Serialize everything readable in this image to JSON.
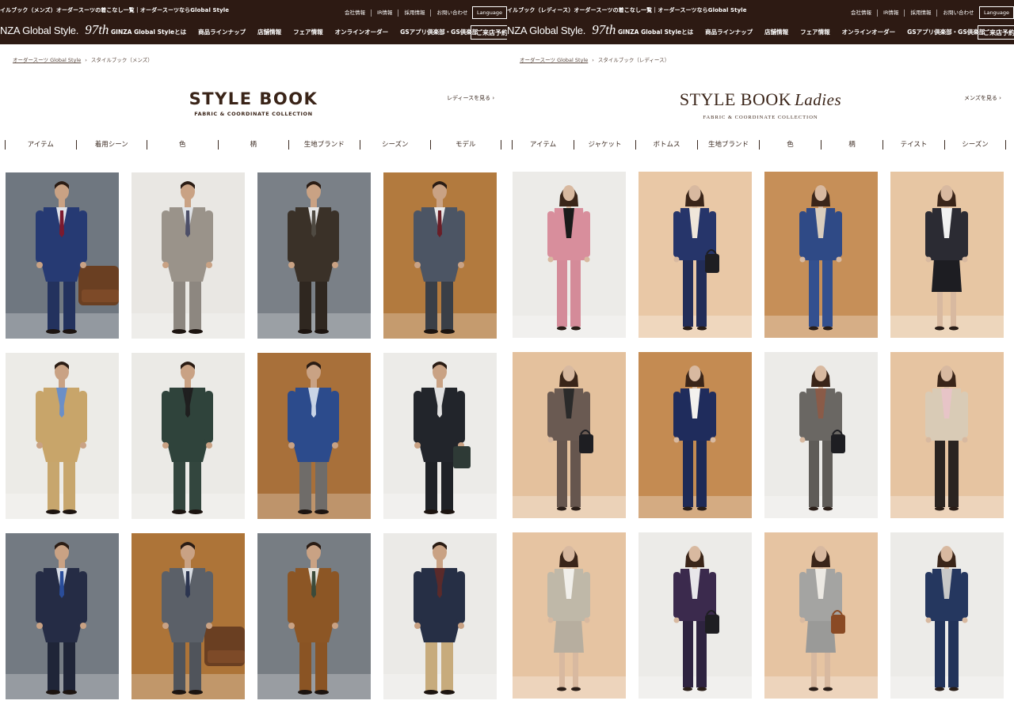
{
  "mens": {
    "site_caption": "イルブック（メンズ）オーダースーツの着こなし一覧｜オーダースーツならGlobal Style",
    "utility_links": [
      "会社情報",
      "IR情報",
      "採用情報",
      "お問い合わせ"
    ],
    "language_label": "Language",
    "logo_text": "NZA Global Style.",
    "logo_97": "97th",
    "nav_items": [
      "GINZA Global Styleとは",
      "商品ラインナップ",
      "店舗情報",
      "フェア情報",
      "オンラインオーダー",
      "GSアプリ倶楽部・GS倶楽部"
    ],
    "reserve_label": "ご来店予約",
    "breadcrumb_home": "オーダースーツ Global Style",
    "breadcrumb_current": "スタイルブック（メンズ）",
    "title": "STYLE BOOK",
    "subtitle": "FABRIC & COORDINATE COLLECTION",
    "switch_link": "レディースを見る ›",
    "filters": [
      "アイテム",
      "着用シーン",
      "色",
      "柄",
      "生地ブランド",
      "シーズン",
      "モデル"
    ],
    "tiles": [
      {
        "bg": "#6f7780",
        "jacket": "#263a73",
        "pants": "#23325e",
        "shirt": "#dfe3ea",
        "tie": "#7b1a2e",
        "prop": "chair"
      },
      {
        "bg": "#e9e7e3",
        "jacket": "#9a938a",
        "pants": "#8d8780",
        "shirt": "#dfe2e6",
        "tie": "#4d4f68",
        "prop": "none"
      },
      {
        "bg": "#7a8087",
        "jacket": "#3a3128",
        "pants": "#2f2720",
        "shirt": "#e6e6e6",
        "tie": "#4f4a42",
        "prop": "none"
      },
      {
        "bg": "#b27a3e",
        "jacket": "#4c5564",
        "pants": "#3a3f47",
        "shirt": "#e8e8e8",
        "tie": "#6a1e27",
        "prop": "none"
      },
      {
        "bg": "#ecebe7",
        "jacket": "#c8a56a",
        "pants": "#c7a66d",
        "shirt": "#6b8fc7",
        "tie": "#6b8fc7",
        "prop": "none"
      },
      {
        "bg": "#ebeae6",
        "jacket": "#2f433b",
        "pants": "#33463e",
        "shirt": "#1f1f1f",
        "tie": "#1f1f1f",
        "prop": "none"
      },
      {
        "bg": "#a8703a",
        "jacket": "#2c4b8c",
        "pants": "#6f6c69",
        "shirt": "#c9d4e6",
        "tie": "#c9d4e6",
        "prop": "none"
      },
      {
        "bg": "#ecebe8",
        "jacket": "#22252b",
        "pants": "#1f2227",
        "shirt": "#e0e0e0",
        "tie": "#e0e0e0",
        "prop": "bag"
      },
      {
        "bg": "#737a82",
        "jacket": "#252c45",
        "pants": "#1f2538",
        "shirt": "#d8dde6",
        "tie": "#2a4d9a",
        "prop": "none"
      },
      {
        "bg": "#ad7438",
        "jacket": "#5b6068",
        "pants": "#50545b",
        "shirt": "#d9dde3",
        "tie": "#2c3550",
        "prop": "chair"
      },
      {
        "bg": "#777d83",
        "jacket": "#8c5625",
        "pants": "#8a5424",
        "shirt": "#e4e0d8",
        "tie": "#3b4a3a",
        "prop": "none"
      },
      {
        "bg": "#ebeae7",
        "jacket": "#262f45",
        "pants": "#c7ab7c",
        "shirt": "#5a2a2a",
        "tie": "#5a2a2a",
        "prop": "none"
      }
    ]
  },
  "ladies": {
    "site_caption": "イルブック（レディース）オーダースーツの着こなし一覧｜オーダースーツならGlobal Style",
    "utility_links": [
      "会社情報",
      "IR情報",
      "採用情報",
      "お問い合わせ"
    ],
    "language_label": "Language",
    "logo_text": "NZA Global Style.",
    "logo_97": "97th",
    "nav_items": [
      "GINZA Global Styleとは",
      "商品ラインナップ",
      "店舗情報",
      "フェア情報",
      "オンラインオーダー",
      "GSアプリ倶楽部・GS倶楽部"
    ],
    "reserve_label": "ご来店予約",
    "breadcrumb_home": "オーダースーツ Global Style",
    "breadcrumb_current": "スタイルブック（レディース）",
    "title": "STYLE BOOK",
    "title_script": "Ladies",
    "subtitle": "FABRIC & COORDINATE COLLECTION",
    "switch_link": "メンズを見る ›",
    "filters": [
      "アイテム",
      "ジャケット",
      "ボトムス",
      "生地ブランド",
      "色",
      "柄",
      "テイスト",
      "シーズン"
    ],
    "tiles": [
      {
        "bg": "#ecebe8",
        "jacket": "#d88e9c",
        "pants": "#d48b99",
        "shirt": "#1a1a1a",
        "prop": "none",
        "skirt": false
      },
      {
        "bg": "#e9c8a6",
        "jacket": "#26356a",
        "pants": "#222d58",
        "shirt": "#efe6da",
        "prop": "bag-dark",
        "skirt": false
      },
      {
        "bg": "#c68f58",
        "jacket": "#2f4a86",
        "pants": "#33508f",
        "shirt": "#d9cdbd",
        "prop": "none",
        "skirt": false
      },
      {
        "bg": "#e7c6a3",
        "jacket": "#2b2b33",
        "pants": "#1d1d22",
        "shirt": "#f1f1f1",
        "prop": "none",
        "skirt": true
      },
      {
        "bg": "#e4c19d",
        "jacket": "#6a5a52",
        "pants": "#66564e",
        "shirt": "#2a2a2a",
        "prop": "bag-dark",
        "skirt": false
      },
      {
        "bg": "#c48b52",
        "jacket": "#1f2c5c",
        "pants": "#1e2a56",
        "shirt": "#f3f1ee",
        "prop": "none",
        "skirt": false
      },
      {
        "bg": "#ecebe8",
        "jacket": "#6a6763",
        "pants": "#5f5c58",
        "shirt": "#8a5b48",
        "prop": "bag-dark",
        "skirt": false
      },
      {
        "bg": "#e6c4a1",
        "jacket": "#d9cbb6",
        "pants": "#2a2421",
        "shirt": "#e7c4c7",
        "prop": "none",
        "skirt": false
      },
      {
        "bg": "#e6c4a2",
        "jacket": "#bfb8a8",
        "pants": "#b7ae9f",
        "shirt": "#f1efea",
        "prop": "none",
        "skirt": true
      },
      {
        "bg": "#ecebe8",
        "jacket": "#3b2a4d",
        "pants": "#2e2340",
        "shirt": "#e8e6ea",
        "prop": "bag-dark",
        "skirt": false
      },
      {
        "bg": "#e6c4a2",
        "jacket": "#a4a4a2",
        "pants": "#9a9a98",
        "shirt": "#ece9e3",
        "prop": "bag-brown",
        "skirt": true
      },
      {
        "bg": "#ecebe8",
        "jacket": "#25375f",
        "pants": "#22335a",
        "shirt": "#c8c8c8",
        "prop": "none",
        "skirt": false
      }
    ]
  }
}
